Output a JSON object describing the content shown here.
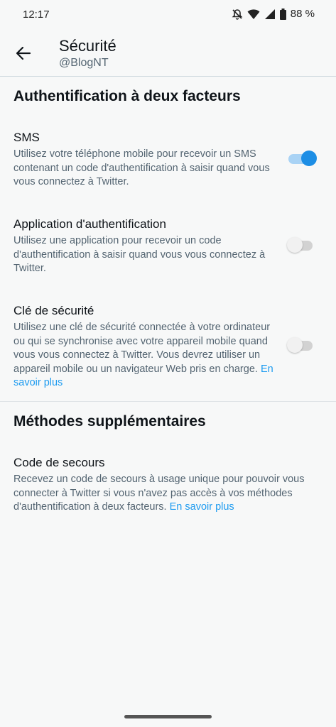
{
  "status_bar": {
    "time": "12:17",
    "battery": "88 %"
  },
  "header": {
    "title": "Sécurité",
    "subtitle": "@BlogNT"
  },
  "section_2fa": {
    "title": "Authentification à deux facteurs"
  },
  "sms": {
    "title": "SMS",
    "description": "Utilisez votre téléphone mobile pour recevoir un SMS contenant un code d'authentification à saisir quand vous vous connectez à Twitter.",
    "enabled": true
  },
  "auth_app": {
    "title": "Application d'authentification",
    "description": "Utilisez une application pour recevoir un code d'authentification à saisir quand vous vous connectez à Twitter.",
    "enabled": false
  },
  "security_key": {
    "title": "Clé de sécurité",
    "description": "Utilisez une clé de sécurité connectée à votre ordinateur ou qui se synchronise avec votre appareil mobile quand vous vous connectez à Twitter. Vous devrez utiliser un appareil mobile ou un navigateur Web pris en charge.",
    "link": "En savoir plus",
    "enabled": false
  },
  "section_more": {
    "title": "Méthodes supplémentaires"
  },
  "backup_code": {
    "title": "Code de secours",
    "description": "Recevez un code de secours à usage unique pour pouvoir vous connecter à Twitter si vous n'avez pas accès à vos méthodes d'authentification à deux facteurs.",
    "link": "En savoir plus"
  },
  "colors": {
    "accent": "#1d9bf0",
    "text": "#0f1419",
    "secondary": "#536471",
    "background": "#f7f8f8"
  }
}
